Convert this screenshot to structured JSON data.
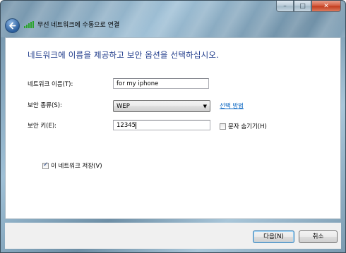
{
  "window": {
    "title": "무선 네트워크에 수동으로 연결",
    "caption": {
      "minimize": "–",
      "maximize": "□",
      "close": "✕"
    }
  },
  "main": {
    "heading": "네트워크에 이름을 제공하고 보안 옵션을 선택하십시오.",
    "network_name": {
      "label": "네트워크 이름(T):",
      "value": "for my iphone"
    },
    "security_type": {
      "label": "보안 종류(S):",
      "value": "WEP",
      "link": "선택 방법"
    },
    "security_key": {
      "label": "보안 키(E):",
      "value": "12345",
      "hide_chars_label": "문자 숨기기(H)",
      "hide_chars_checked": false
    },
    "save_network": {
      "label": "이 네트워크 저장(V)",
      "checked": true
    }
  },
  "footer": {
    "next_label": "다음(N)",
    "cancel_label": "취소"
  },
  "colors": {
    "heading": "#1e3a8a",
    "link": "#0a66c2",
    "signal": "#29a329"
  },
  "icons": {
    "back": "back-arrow-icon",
    "signal": "wireless-signal-icon",
    "dropdown": "chevron-down-icon"
  }
}
